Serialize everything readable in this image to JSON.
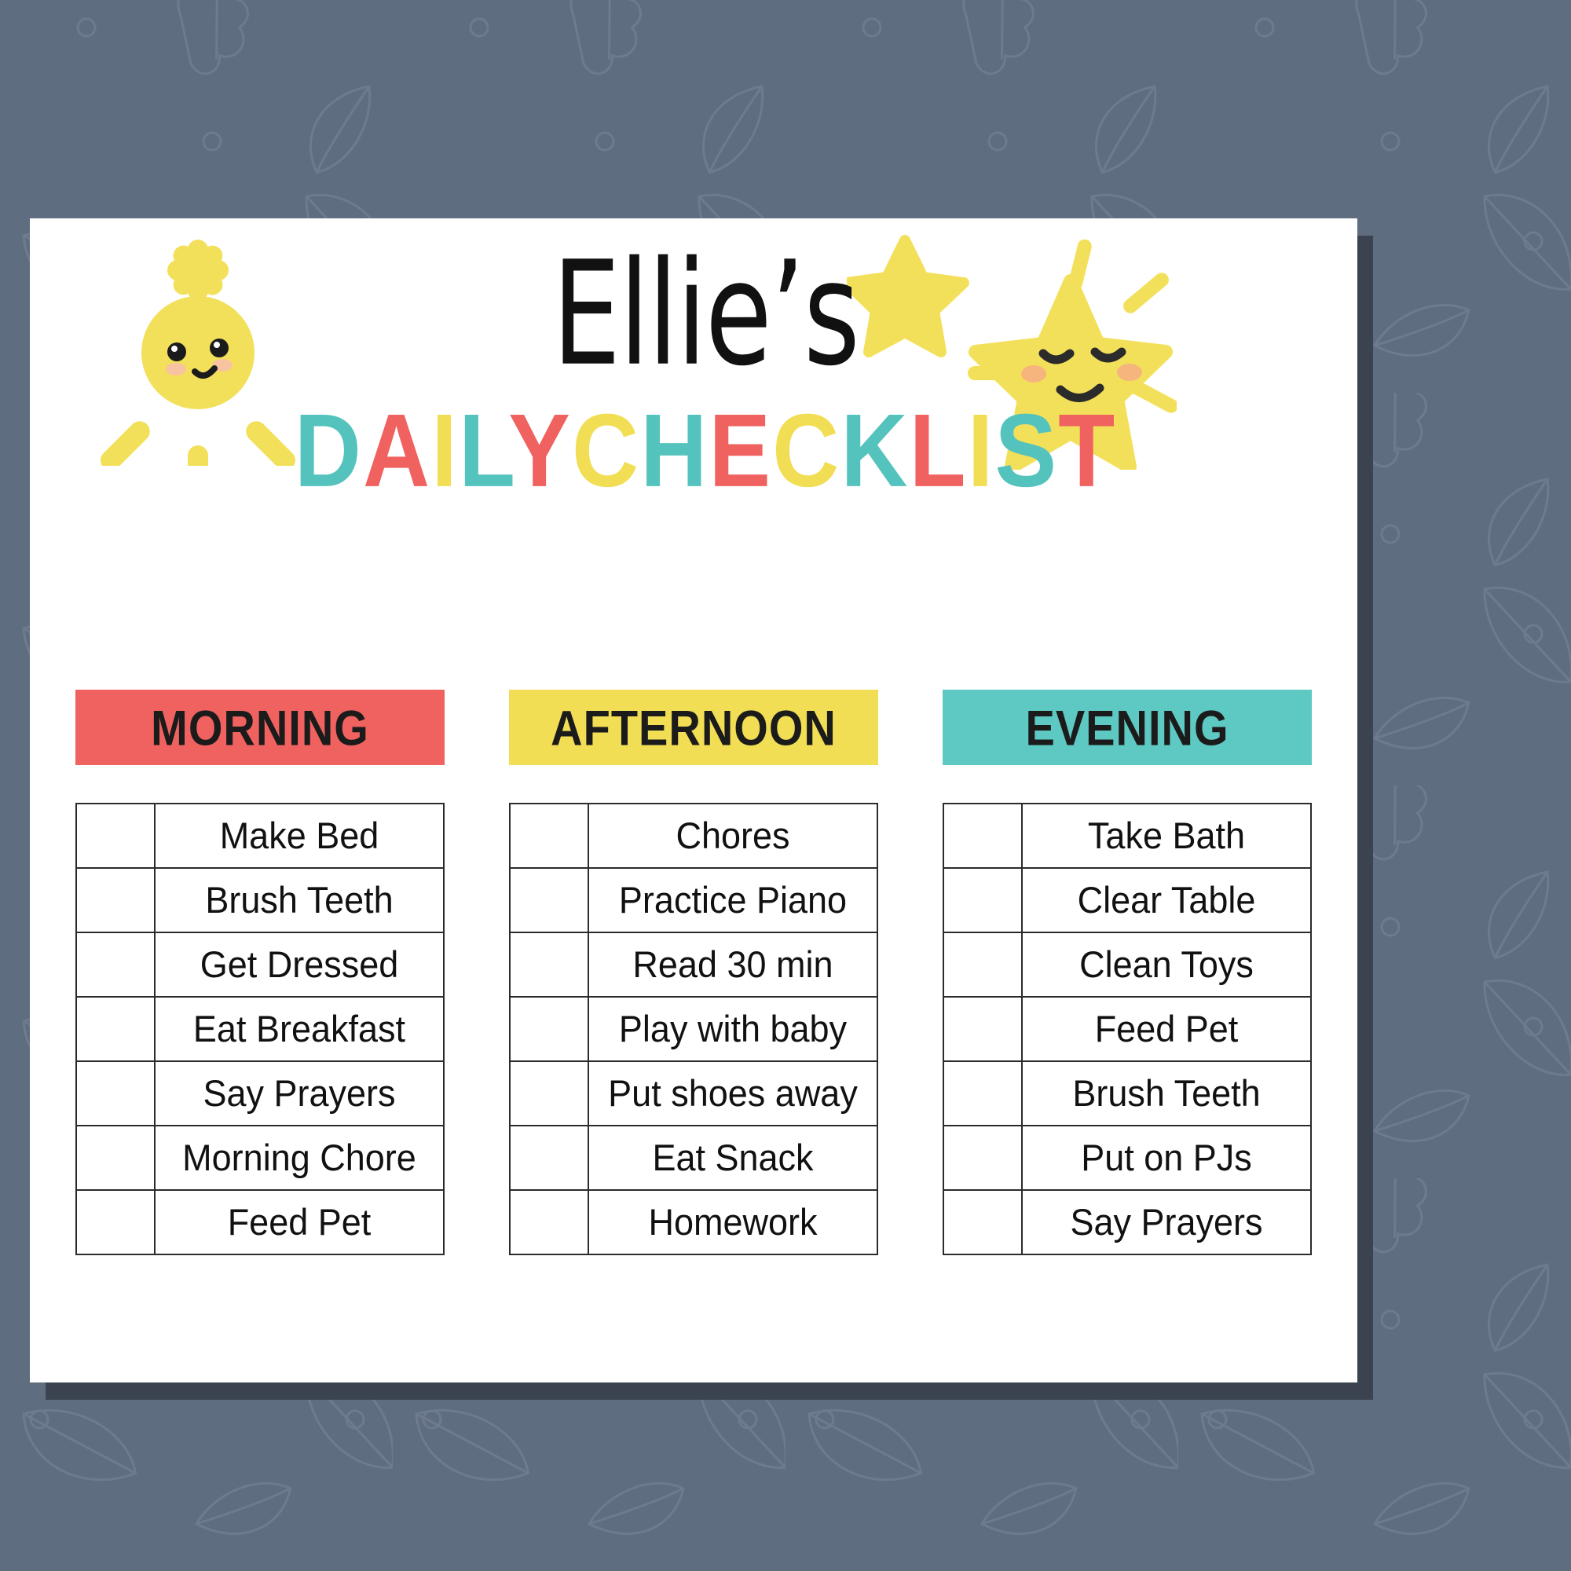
{
  "page": {
    "background_color": "#5f6d80",
    "card_color": "#ffffff",
    "card_shadow_color": "#3b4350"
  },
  "header": {
    "name_title": "Ellie’s",
    "subtitle_text": "DAILY CHECKLIST",
    "subtitle_letters": [
      {
        "ch": "D",
        "color": "#55c3bd"
      },
      {
        "ch": "A",
        "color": "#f0625f"
      },
      {
        "ch": "I",
        "color": "#f2de54"
      },
      {
        "ch": "L",
        "color": "#55c3bd"
      },
      {
        "ch": "Y",
        "color": "#f0625f"
      },
      {
        "ch": " ",
        "color": "#ffffff"
      },
      {
        "ch": "C",
        "color": "#f2de54"
      },
      {
        "ch": "H",
        "color": "#55c3bd"
      },
      {
        "ch": "E",
        "color": "#f0625f"
      },
      {
        "ch": "C",
        "color": "#f2de54"
      },
      {
        "ch": "K",
        "color": "#55c3bd"
      },
      {
        "ch": "L",
        "color": "#f0625f"
      },
      {
        "ch": "I",
        "color": "#f2de54"
      },
      {
        "ch": "S",
        "color": "#55c3bd"
      },
      {
        "ch": "T",
        "color": "#f0625f"
      }
    ],
    "sun_icon": "smiling-sun-icon",
    "star_icon": "smiling-star-icon",
    "small_star_icon": "small-star-icon"
  },
  "columns": [
    {
      "id": "morning",
      "title": "MORNING",
      "header_color": "#f0625f",
      "items": [
        "Make Bed",
        "Brush Teeth",
        "Get Dressed",
        "Eat Breakfast",
        "Say Prayers",
        "Morning Chore",
        "Feed Pet"
      ]
    },
    {
      "id": "afternoon",
      "title": "AFTERNOON",
      "header_color": "#f2de54",
      "items": [
        "Chores",
        "Practice Piano",
        "Read 30 min",
        "Play with baby",
        "Put shoes away",
        "Eat Snack",
        "Homework"
      ]
    },
    {
      "id": "evening",
      "title": "EVENING",
      "header_color": "#5ec8c2",
      "items": [
        "Take Bath",
        "Clear Table",
        "Clean Toys",
        "Feed Pet",
        "Brush Teeth",
        "Put on PJs",
        "Say Prayers"
      ]
    }
  ]
}
